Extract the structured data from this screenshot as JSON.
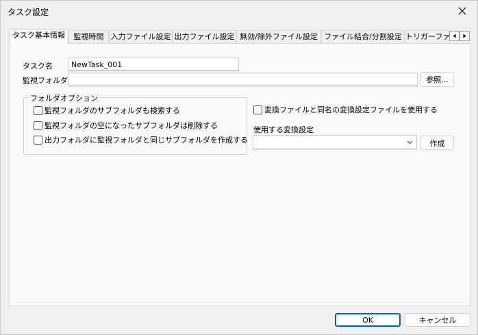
{
  "window": {
    "title": "タスク設定"
  },
  "tabs": [
    {
      "label": "タスク基本情報",
      "active": true
    },
    {
      "label": "監視時間"
    },
    {
      "label": "入力ファイル設定"
    },
    {
      "label": "出力ファイル設定"
    },
    {
      "label": "無効/除外ファイル設定"
    },
    {
      "label": "ファイル結合/分割設定"
    },
    {
      "label": "トリガーファイ"
    }
  ],
  "basic": {
    "task_name_label": "タスク名",
    "task_name_value": "NewTask_001",
    "watch_folder_label": "監視フォルダ",
    "watch_folder_value": "",
    "browse_button": "参照..."
  },
  "folder_options": {
    "legend": "フォルダオプション",
    "items": [
      {
        "label": "監視フォルダのサブフォルダも検索する",
        "checked": false
      },
      {
        "label": "監視フォルダの空になったサブフォルダは削除する",
        "checked": false
      },
      {
        "label": "出力フォルダに監視フォルダと同じサブフォルダを作成する",
        "checked": false
      }
    ]
  },
  "conversion": {
    "same_name_checkbox": "変換ファイルと同名の変換設定ファイルを使用する",
    "same_name_checked": false,
    "settings_label": "使用する変換設定",
    "selected_value": "",
    "create_button": "作成"
  },
  "footer": {
    "ok": "OK",
    "cancel": "キャンセル"
  },
  "icons": {
    "close": "close-icon",
    "tab_scroll_left": "triangle-left-icon",
    "tab_scroll_right": "triangle-right-icon",
    "dropdown": "chevron-down-icon"
  },
  "colors": {
    "default_button_border": "#005fb8",
    "panel_bg": "#f9f9f9",
    "window_bg": "#f0f0f0"
  }
}
